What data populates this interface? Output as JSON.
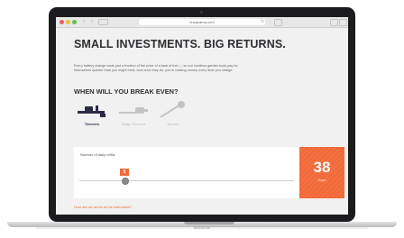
{
  "browser": {
    "address": "husqvarna.com",
    "back_icon": "chevron-left-icon",
    "forward_icon": "chevron-right-icon",
    "reload_icon": "reload-icon"
  },
  "page": {
    "headline": "SMALL INVESTMENTS. BIG RETURNS.",
    "intro": "Every battery charge costs just a fraction of the price of a tank of fuel — so our cordless garden tools pay for themselves quicker than you might think. And once they do, you're making money every time you charge.",
    "subheading": "WHEN WILL YOU BREAK EVEN?",
    "tools": [
      {
        "label": "Trimmers",
        "icon": "trimmer-icon",
        "selected": true
      },
      {
        "label": "Hedge Trimmers",
        "icon": "hedge-trimmer-icon",
        "selected": false
      },
      {
        "label": "Blowers",
        "icon": "blower-icon",
        "selected": false
      }
    ],
    "slider": {
      "label": "Number of daily refills",
      "value": "5"
    },
    "result": {
      "value": "38",
      "unit": "Days"
    },
    "estimate_link": "How did we arrive at the estimation?"
  },
  "device": {
    "brand": "MacBook"
  },
  "colors": {
    "accent": "#f26a3a",
    "heading": "#2f2f33",
    "selected_tool": "#2b2b45"
  }
}
